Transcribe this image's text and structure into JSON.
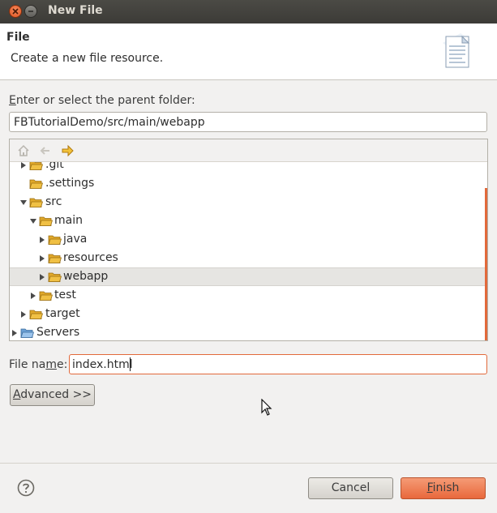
{
  "window": {
    "title": "New File"
  },
  "banner": {
    "title": "File",
    "description": "Create a new file resource."
  },
  "parent_folder": {
    "label_accel": "E",
    "label_rest": "nter or select the parent folder:",
    "value": "FBTutorialDemo/src/main/webapp"
  },
  "toolbar": {
    "icons": [
      "home-icon",
      "back-icon",
      "forward-icon"
    ]
  },
  "tree": {
    "items": [
      {
        "label": ".git",
        "expander": "collapsed",
        "selected": false
      },
      {
        "label": ".settings",
        "expander": "none",
        "selected": false
      },
      {
        "label": "src",
        "expander": "expanded",
        "selected": false
      },
      {
        "label": "main",
        "expander": "expanded",
        "selected": false
      },
      {
        "label": "java",
        "expander": "collapsed",
        "selected": false
      },
      {
        "label": "resources",
        "expander": "collapsed",
        "selected": false
      },
      {
        "label": "webapp",
        "expander": "collapsed",
        "selected": true
      },
      {
        "label": "test",
        "expander": "collapsed",
        "selected": false
      },
      {
        "label": "target",
        "expander": "collapsed",
        "selected": false
      },
      {
        "label": "Servers",
        "expander": "collapsed",
        "selected": false
      }
    ]
  },
  "file_name": {
    "label_pre": "File na",
    "label_accel": "m",
    "label_post": "e:",
    "value": "index.html"
  },
  "buttons": {
    "advanced_accel": "A",
    "advanced_rest": "dvanced >>",
    "cancel": "Cancel",
    "finish_accel": "F",
    "finish_rest": "inish"
  },
  "colors": {
    "accent": "#e9683c",
    "titlebar": "#3c3b37",
    "folder": "#f0c044"
  }
}
